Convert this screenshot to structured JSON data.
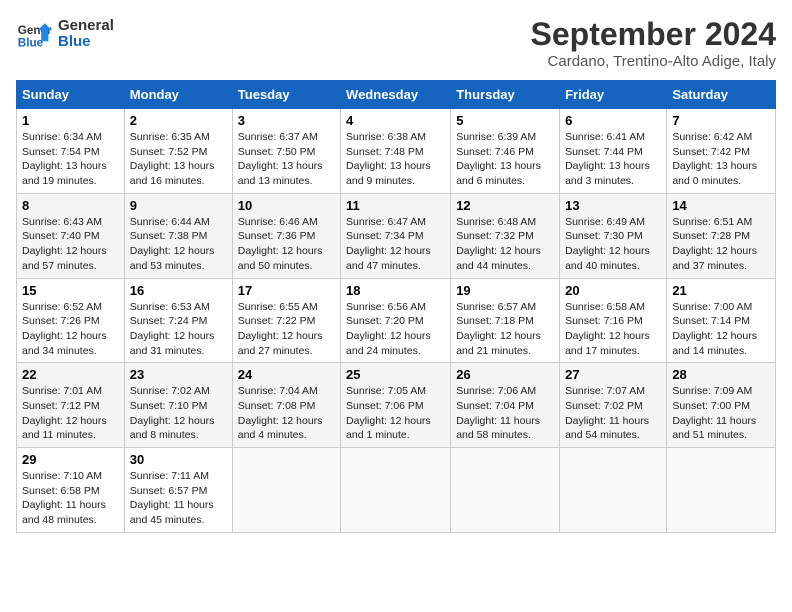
{
  "header": {
    "logo_line1": "General",
    "logo_line2": "Blue",
    "month": "September 2024",
    "location": "Cardano, Trentino-Alto Adige, Italy"
  },
  "columns": [
    "Sunday",
    "Monday",
    "Tuesday",
    "Wednesday",
    "Thursday",
    "Friday",
    "Saturday"
  ],
  "weeks": [
    [
      {
        "day": "1",
        "info": "Sunrise: 6:34 AM\nSunset: 7:54 PM\nDaylight: 13 hours\nand 19 minutes."
      },
      {
        "day": "2",
        "info": "Sunrise: 6:35 AM\nSunset: 7:52 PM\nDaylight: 13 hours\nand 16 minutes."
      },
      {
        "day": "3",
        "info": "Sunrise: 6:37 AM\nSunset: 7:50 PM\nDaylight: 13 hours\nand 13 minutes."
      },
      {
        "day": "4",
        "info": "Sunrise: 6:38 AM\nSunset: 7:48 PM\nDaylight: 13 hours\nand 9 minutes."
      },
      {
        "day": "5",
        "info": "Sunrise: 6:39 AM\nSunset: 7:46 PM\nDaylight: 13 hours\nand 6 minutes."
      },
      {
        "day": "6",
        "info": "Sunrise: 6:41 AM\nSunset: 7:44 PM\nDaylight: 13 hours\nand 3 minutes."
      },
      {
        "day": "7",
        "info": "Sunrise: 6:42 AM\nSunset: 7:42 PM\nDaylight: 13 hours\nand 0 minutes."
      }
    ],
    [
      {
        "day": "8",
        "info": "Sunrise: 6:43 AM\nSunset: 7:40 PM\nDaylight: 12 hours\nand 57 minutes."
      },
      {
        "day": "9",
        "info": "Sunrise: 6:44 AM\nSunset: 7:38 PM\nDaylight: 12 hours\nand 53 minutes."
      },
      {
        "day": "10",
        "info": "Sunrise: 6:46 AM\nSunset: 7:36 PM\nDaylight: 12 hours\nand 50 minutes."
      },
      {
        "day": "11",
        "info": "Sunrise: 6:47 AM\nSunset: 7:34 PM\nDaylight: 12 hours\nand 47 minutes."
      },
      {
        "day": "12",
        "info": "Sunrise: 6:48 AM\nSunset: 7:32 PM\nDaylight: 12 hours\nand 44 minutes."
      },
      {
        "day": "13",
        "info": "Sunrise: 6:49 AM\nSunset: 7:30 PM\nDaylight: 12 hours\nand 40 minutes."
      },
      {
        "day": "14",
        "info": "Sunrise: 6:51 AM\nSunset: 7:28 PM\nDaylight: 12 hours\nand 37 minutes."
      }
    ],
    [
      {
        "day": "15",
        "info": "Sunrise: 6:52 AM\nSunset: 7:26 PM\nDaylight: 12 hours\nand 34 minutes."
      },
      {
        "day": "16",
        "info": "Sunrise: 6:53 AM\nSunset: 7:24 PM\nDaylight: 12 hours\nand 31 minutes."
      },
      {
        "day": "17",
        "info": "Sunrise: 6:55 AM\nSunset: 7:22 PM\nDaylight: 12 hours\nand 27 minutes."
      },
      {
        "day": "18",
        "info": "Sunrise: 6:56 AM\nSunset: 7:20 PM\nDaylight: 12 hours\nand 24 minutes."
      },
      {
        "day": "19",
        "info": "Sunrise: 6:57 AM\nSunset: 7:18 PM\nDaylight: 12 hours\nand 21 minutes."
      },
      {
        "day": "20",
        "info": "Sunrise: 6:58 AM\nSunset: 7:16 PM\nDaylight: 12 hours\nand 17 minutes."
      },
      {
        "day": "21",
        "info": "Sunrise: 7:00 AM\nSunset: 7:14 PM\nDaylight: 12 hours\nand 14 minutes."
      }
    ],
    [
      {
        "day": "22",
        "info": "Sunrise: 7:01 AM\nSunset: 7:12 PM\nDaylight: 12 hours\nand 11 minutes."
      },
      {
        "day": "23",
        "info": "Sunrise: 7:02 AM\nSunset: 7:10 PM\nDaylight: 12 hours\nand 8 minutes."
      },
      {
        "day": "24",
        "info": "Sunrise: 7:04 AM\nSunset: 7:08 PM\nDaylight: 12 hours\nand 4 minutes."
      },
      {
        "day": "25",
        "info": "Sunrise: 7:05 AM\nSunset: 7:06 PM\nDaylight: 12 hours\nand 1 minute."
      },
      {
        "day": "26",
        "info": "Sunrise: 7:06 AM\nSunset: 7:04 PM\nDaylight: 11 hours\nand 58 minutes."
      },
      {
        "day": "27",
        "info": "Sunrise: 7:07 AM\nSunset: 7:02 PM\nDaylight: 11 hours\nand 54 minutes."
      },
      {
        "day": "28",
        "info": "Sunrise: 7:09 AM\nSunset: 7:00 PM\nDaylight: 11 hours\nand 51 minutes."
      }
    ],
    [
      {
        "day": "29",
        "info": "Sunrise: 7:10 AM\nSunset: 6:58 PM\nDaylight: 11 hours\nand 48 minutes."
      },
      {
        "day": "30",
        "info": "Sunrise: 7:11 AM\nSunset: 6:57 PM\nDaylight: 11 hours\nand 45 minutes."
      },
      null,
      null,
      null,
      null,
      null
    ]
  ]
}
